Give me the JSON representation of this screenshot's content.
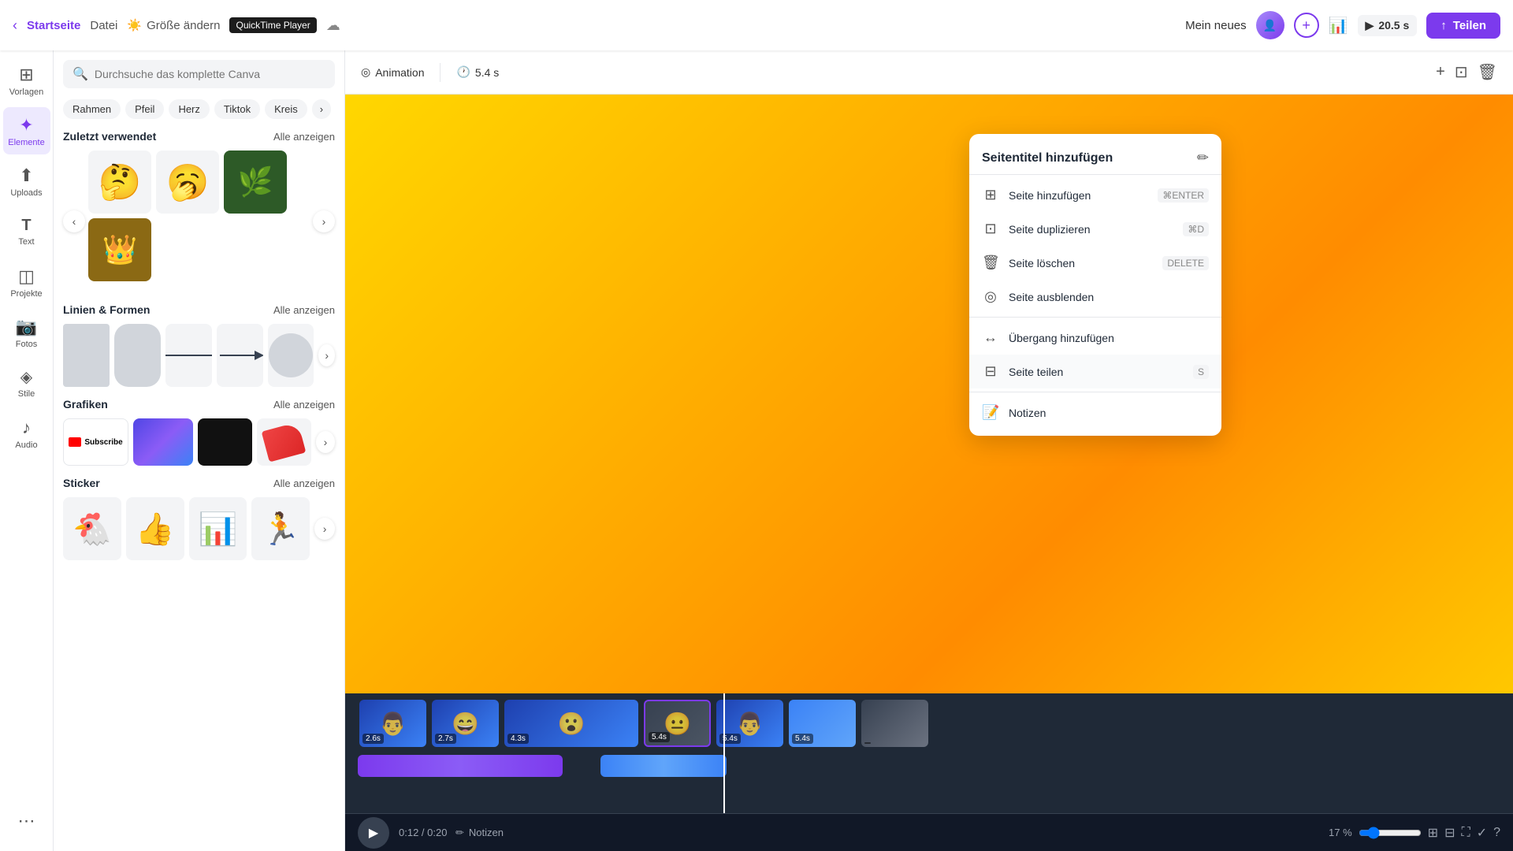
{
  "topbar": {
    "back_label": "Startseite",
    "file_label": "Datei",
    "size_label": "Größe ändern",
    "quicktime": "QuickTime Player",
    "project_title": "Mein neues",
    "duration": "20.5 s",
    "share_label": "Teilen"
  },
  "sidebar": {
    "items": [
      {
        "icon": "⊞",
        "label": "Vorlagen",
        "id": "vorlagen"
      },
      {
        "icon": "✦",
        "label": "Elemente",
        "id": "elemente",
        "active": true
      },
      {
        "icon": "↑",
        "label": "Uploads",
        "id": "uploads"
      },
      {
        "icon": "T",
        "label": "Text",
        "id": "text"
      },
      {
        "icon": "◫",
        "label": "Projekte",
        "id": "projekte"
      },
      {
        "icon": "📷",
        "label": "Fotos",
        "id": "fotos"
      },
      {
        "icon": "✦",
        "label": "Stile",
        "id": "stile"
      },
      {
        "icon": "♪",
        "label": "Audio",
        "id": "audio"
      }
    ]
  },
  "left_panel": {
    "search_placeholder": "Durchsuche das komplette Canva",
    "tags": [
      "Rahmen",
      "Pfeil",
      "Herz",
      "Tiktok",
      "Kreis"
    ],
    "recently_used_title": "Zuletzt verwendet",
    "recently_used_link": "Alle anzeigen",
    "lines_shapes_title": "Linien & Formen",
    "lines_shapes_link": "Alle anzeigen",
    "graphics_title": "Grafiken",
    "graphics_link": "Alle anzeigen",
    "stickers_title": "Sticker",
    "stickers_link": "Alle anzeigen"
  },
  "canvas_toolbar": {
    "animation_label": "Animation",
    "duration_label": "5.4 s"
  },
  "context_menu": {
    "title": "Seitentitel hinzufügen",
    "items": [
      {
        "icon": "⊞",
        "label": "Seite hinzufügen",
        "shortcut": "⌘ENTER",
        "id": "add-page"
      },
      {
        "icon": "⊡",
        "label": "Seite duplizieren",
        "shortcut": "⌘D",
        "id": "dup-page"
      },
      {
        "icon": "🗑",
        "label": "Seite löschen",
        "shortcut": "DELETE",
        "id": "del-page"
      },
      {
        "icon": "◎",
        "label": "Seite ausblenden",
        "shortcut": "",
        "id": "hide-page"
      },
      {
        "divider": true
      },
      {
        "icon": "↔",
        "label": "Übergang hinzufügen",
        "shortcut": "",
        "id": "add-transition"
      },
      {
        "icon": "⊟",
        "label": "Seite teilen",
        "shortcut": "S",
        "id": "split-page",
        "active": true
      },
      {
        "divider": true
      },
      {
        "icon": "📝",
        "label": "Notizen",
        "shortcut": "",
        "id": "notes"
      }
    ]
  },
  "timeline": {
    "play_label": "▶",
    "time_label": "0:12 / 0:20",
    "zoom_label": "17 %",
    "notes_label": "Notizen"
  }
}
